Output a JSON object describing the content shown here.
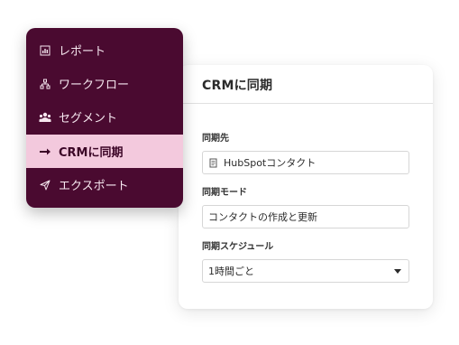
{
  "nav": {
    "items": [
      {
        "label": "レポート",
        "icon": "report-icon"
      },
      {
        "label": "ワークフロー",
        "icon": "workflow-icon"
      },
      {
        "label": "セグメント",
        "icon": "segment-icon"
      },
      {
        "label": "CRMに同期",
        "icon": "arrow-right-icon",
        "active": true
      },
      {
        "label": "エクスポート",
        "icon": "send-icon"
      }
    ]
  },
  "sync_card": {
    "title": "CRMに同期",
    "destination": {
      "label": "同期先",
      "value": "HubSpotコンタクト",
      "icon": "document-icon"
    },
    "mode": {
      "label": "同期モード",
      "value": "コンタクトの作成と更新"
    },
    "schedule": {
      "label": "同期スケジュール",
      "value": "1時間ごと"
    }
  },
  "colors": {
    "nav_background": "#4a0a30",
    "nav_active_background": "#f3c9dd",
    "nav_text": "#f6e7ef"
  }
}
